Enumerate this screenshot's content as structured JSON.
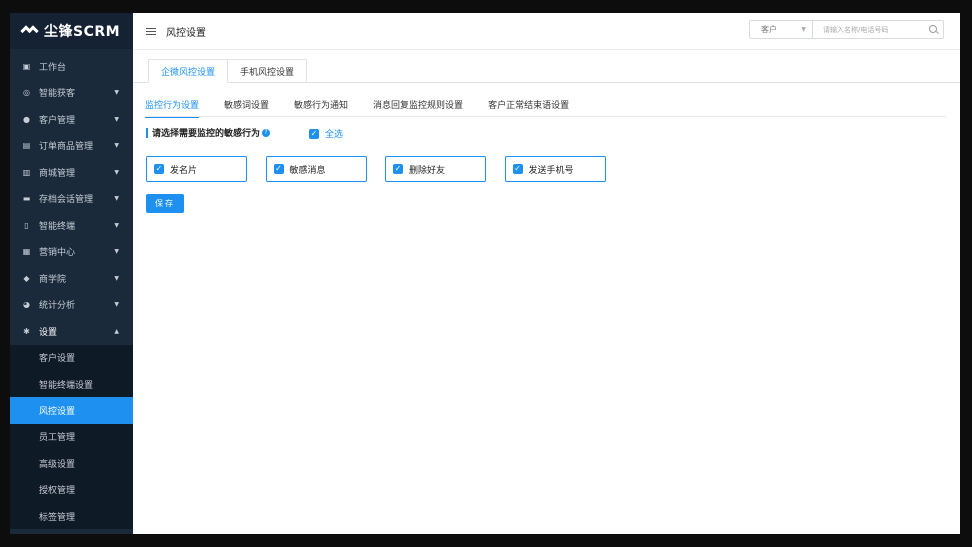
{
  "app": {
    "logo_text": "尘锋SCRM"
  },
  "sidebar": {
    "items": [
      {
        "label": "工作台",
        "icon": "monitor-icon",
        "glyph": "▣",
        "has_caret": false
      },
      {
        "label": "智能获客",
        "icon": "target-icon",
        "glyph": "◎",
        "has_caret": true
      },
      {
        "label": "客户管理",
        "icon": "user-icon",
        "glyph": "●",
        "has_caret": true
      },
      {
        "label": "订单商品管理",
        "icon": "clipboard-icon",
        "glyph": "▤",
        "has_caret": true
      },
      {
        "label": "商城管理",
        "icon": "store-icon",
        "glyph": "▥",
        "has_caret": true
      },
      {
        "label": "存档会话管理",
        "icon": "chat-icon",
        "glyph": "▬",
        "has_caret": true
      },
      {
        "label": "智能终端",
        "icon": "phone-icon",
        "glyph": "▯",
        "has_caret": true
      },
      {
        "label": "营销中心",
        "icon": "calendar-icon",
        "glyph": "▦",
        "has_caret": true
      },
      {
        "label": "商学院",
        "icon": "graduation-cap-icon",
        "glyph": "◆",
        "has_caret": true
      },
      {
        "label": "统计分析",
        "icon": "pie-chart-icon",
        "glyph": "◕",
        "has_caret": true
      },
      {
        "label": "设置",
        "icon": "gear-icon",
        "glyph": "✱",
        "has_caret": true
      }
    ],
    "settings_children": [
      {
        "label": "客户设置"
      },
      {
        "label": "智能终端设置"
      },
      {
        "label": "风控设置"
      },
      {
        "label": "员工管理"
      },
      {
        "label": "高级设置"
      },
      {
        "label": "授权管理"
      },
      {
        "label": "标签管理"
      }
    ]
  },
  "header": {
    "title": "风控设置",
    "search_scope": "客户",
    "search_placeholder": "请输入名称/电话号码"
  },
  "tabs": [
    {
      "label": "企微风控设置",
      "active": true
    },
    {
      "label": "手机风控设置",
      "active": false
    }
  ],
  "subtabs": [
    {
      "label": "监控行为设置",
      "active": true
    },
    {
      "label": "敏感词设置",
      "active": false
    },
    {
      "label": "敏感行为通知",
      "active": false
    },
    {
      "label": "消息回复监控规则设置",
      "active": false
    },
    {
      "label": "客户正常结束语设置",
      "active": false
    }
  ],
  "content": {
    "section_title": "请选择需要监控的敏感行为",
    "help_icon": "?",
    "select_all_label": "全选",
    "select_all_checked": true,
    "options": [
      {
        "label": "发名片",
        "checked": true
      },
      {
        "label": "敏感消息",
        "checked": true
      },
      {
        "label": "删除好友",
        "checked": true
      },
      {
        "label": "发送手机号",
        "checked": true
      }
    ],
    "save_label": "保存"
  },
  "colors": {
    "accent": "#1e90f0",
    "sidebar_bg": "#1b2a3b",
    "sidebar_sub_bg": "#0f1a27"
  }
}
